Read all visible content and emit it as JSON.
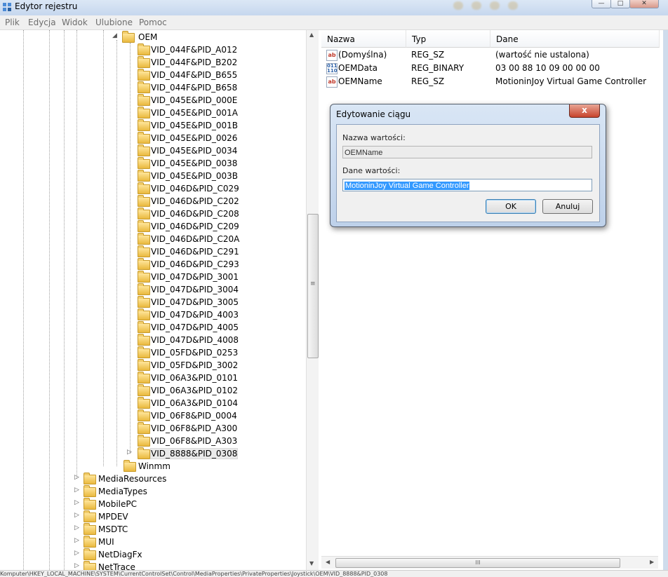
{
  "window": {
    "title": "Edytor rejestru"
  },
  "menu": [
    "Plik",
    "Edycja",
    "Widok",
    "Ulubione",
    "Pomoc"
  ],
  "tree": {
    "parent": "OEM",
    "children": [
      "VID_044F&PID_A012",
      "VID_044F&PID_B202",
      "VID_044F&PID_B655",
      "VID_044F&PID_B658",
      "VID_045E&PID_000E",
      "VID_045E&PID_001A",
      "VID_045E&PID_001B",
      "VID_045E&PID_0026",
      "VID_045E&PID_0034",
      "VID_045E&PID_0038",
      "VID_045E&PID_003B",
      "VID_046D&PID_C029",
      "VID_046D&PID_C202",
      "VID_046D&PID_C208",
      "VID_046D&PID_C209",
      "VID_046D&PID_C20A",
      "VID_046D&PID_C291",
      "VID_046D&PID_C293",
      "VID_047D&PID_3001",
      "VID_047D&PID_3004",
      "VID_047D&PID_3005",
      "VID_047D&PID_4003",
      "VID_047D&PID_4005",
      "VID_047D&PID_4008",
      "VID_05FD&PID_0253",
      "VID_05FD&PID_3002",
      "VID_06A3&PID_0101",
      "VID_06A3&PID_0102",
      "VID_06A3&PID_0104",
      "VID_06F8&PID_0004",
      "VID_06F8&PID_A300",
      "VID_06F8&PID_A303",
      "VID_8888&PID_0308"
    ],
    "sibling": "Winmm",
    "root_items": [
      "MediaResources",
      "MediaTypes",
      "MobilePC",
      "MPDEV",
      "MSDTC",
      "MUI",
      "NetDiagFx",
      "NetTrace"
    ]
  },
  "values": {
    "headers": {
      "name": "Nazwa",
      "type": "Typ",
      "data": "Dane"
    },
    "rows": [
      {
        "name": "(Domyślna)",
        "type": "REG_SZ",
        "data": "(wartość nie ustalona)",
        "icon": "string-value-icon"
      },
      {
        "name": "OEMData",
        "type": "REG_BINARY",
        "data": "03 00 88 10 09 00 00 00",
        "icon": "binary-value-icon"
      },
      {
        "name": "OEMName",
        "type": "REG_SZ",
        "data": "MotioninJoy Virtual Game Controller",
        "icon": "string-value-icon"
      }
    ]
  },
  "dialog": {
    "title": "Edytowanie ciągu",
    "name_label": "Nazwa wartości:",
    "name_value": "OEMName",
    "data_label": "Dane wartości:",
    "data_value": "MotioninJoy Virtual Game Controller",
    "ok": "OK",
    "cancel": "Anuluj",
    "close": "x"
  },
  "hscroll_grip": "III",
  "vscroll_grip": "≡",
  "statusbar": "Komputer\\HKEY_LOCAL_MACHINE\\SYSTEM\\CurrentControlSet\\Control\\MediaProperties\\PrivateProperties\\Joystick\\OEM\\VID_8888&PID_0308",
  "icon_chars": {
    "string": "ab",
    "binary": "011\n110"
  }
}
